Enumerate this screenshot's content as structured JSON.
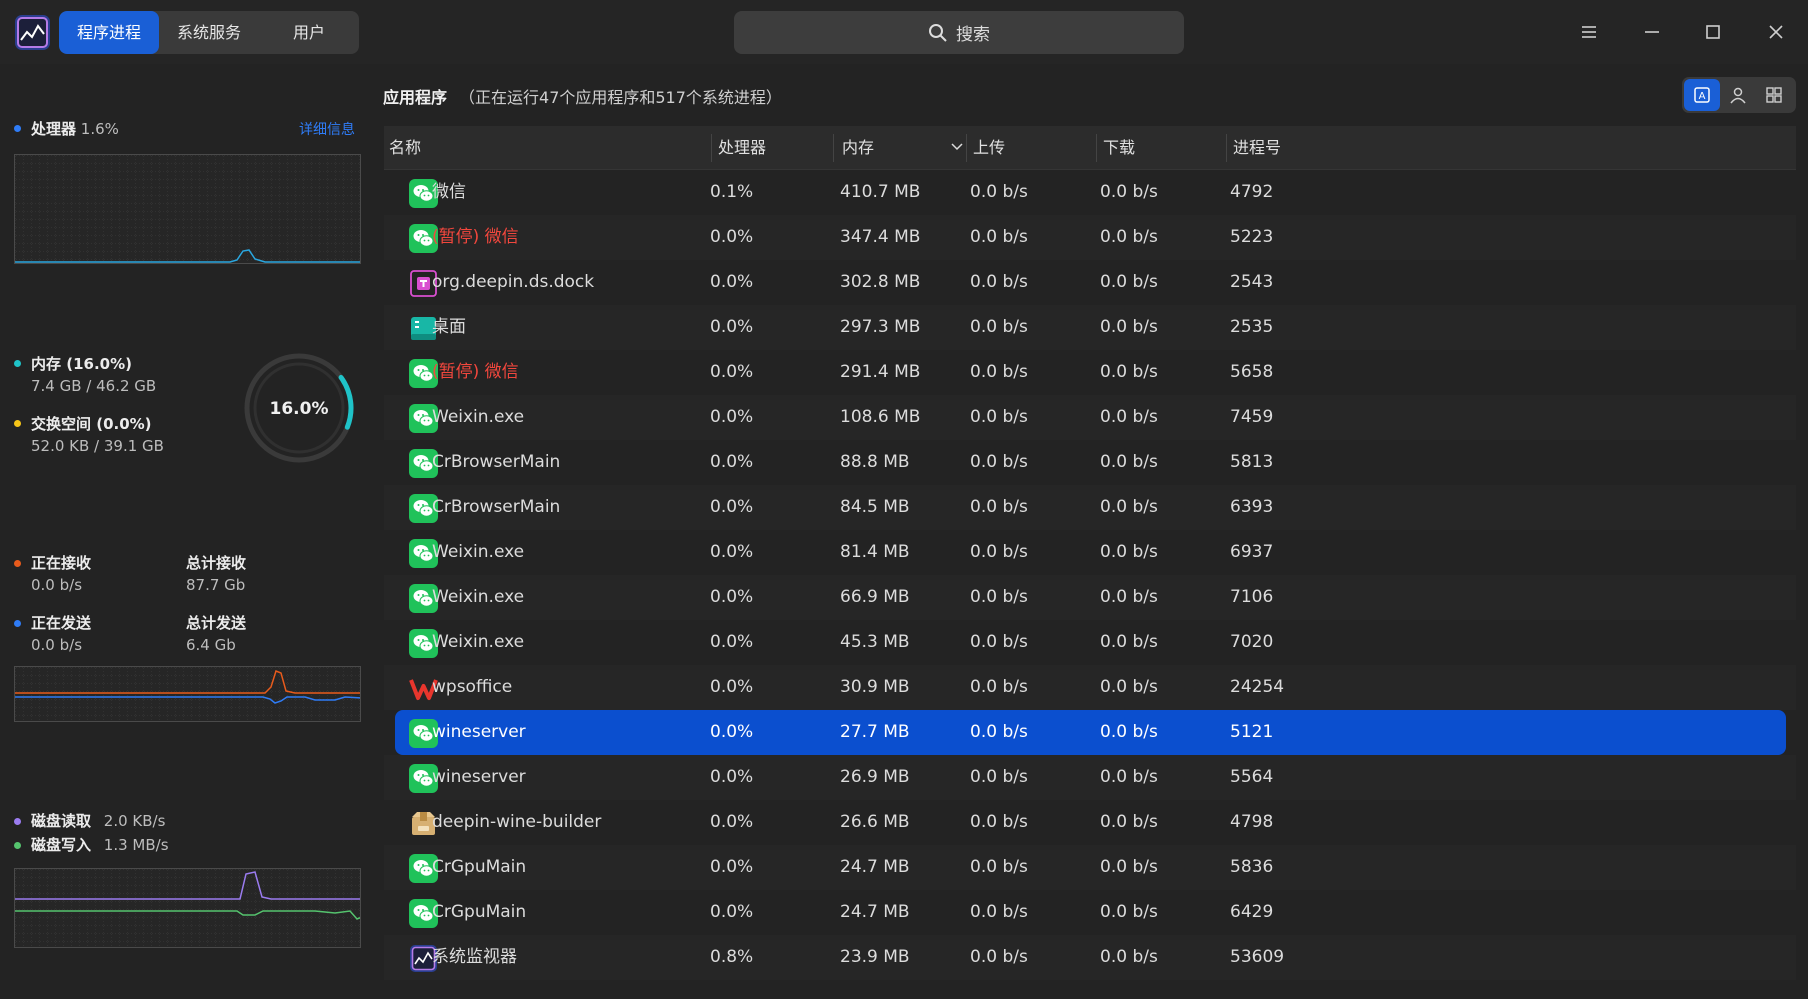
{
  "tabs": [
    "程序进程",
    "系统服务",
    "用户"
  ],
  "search": {
    "label": "搜索"
  },
  "sidebar": {
    "cpu": {
      "label": "处理器",
      "value": "1.6%",
      "detail_link": "详细信息"
    },
    "memory": {
      "label": "内存 (16.0%)",
      "usage": "7.4 GB / 46.2 GB",
      "ring_label": "16.0%",
      "ring_fraction": 0.16
    },
    "swap": {
      "label": "交换空间 (0.0%)",
      "usage": "52.0 KB / 39.1 GB"
    },
    "network": {
      "receiving_label": "正在接收",
      "receiving_value": "0.0 b/s",
      "total_recv_label": "总计接收",
      "total_recv_value": "87.7 Gb",
      "sending_label": "正在发送",
      "sending_value": "0.0 b/s",
      "total_send_label": "总计发送",
      "total_send_value": "6.4 Gb"
    },
    "disk": {
      "read_label": "磁盘读取",
      "read_value": "2.0 KB/s",
      "write_label": "磁盘写入",
      "write_value": "1.3 MB/s"
    }
  },
  "main": {
    "title": "应用程序",
    "subtitle": "（正在运行47个应用程序和517个系统进程）",
    "columns": [
      "名称",
      "处理器",
      "内存",
      "上传",
      "下载",
      "进程号"
    ],
    "rows": [
      {
        "icon": "wechat-icon",
        "name": "微信",
        "cpu": "0.1%",
        "mem": "410.7 MB",
        "up": "0.0 b/s",
        "down": "0.0 b/s",
        "pid": "4792"
      },
      {
        "icon": "wechat-icon",
        "name": "(暂停) 微信",
        "paused": true,
        "cpu": "0.0%",
        "mem": "347.4 MB",
        "up": "0.0 b/s",
        "down": "0.0 b/s",
        "pid": "5223"
      },
      {
        "icon": "dock-icon",
        "name": "org.deepin.ds.dock",
        "cpu": "0.0%",
        "mem": "302.8 MB",
        "up": "0.0 b/s",
        "down": "0.0 b/s",
        "pid": "2543"
      },
      {
        "icon": "desktop-icon",
        "name": "桌面",
        "cpu": "0.0%",
        "mem": "297.3 MB",
        "up": "0.0 b/s",
        "down": "0.0 b/s",
        "pid": "2535"
      },
      {
        "icon": "wechat-icon",
        "name": "(暂停) 微信",
        "paused": true,
        "cpu": "0.0%",
        "mem": "291.4 MB",
        "up": "0.0 b/s",
        "down": "0.0 b/s",
        "pid": "5658"
      },
      {
        "icon": "wechat-icon",
        "name": "Weixin.exe",
        "cpu": "0.0%",
        "mem": "108.6 MB",
        "up": "0.0 b/s",
        "down": "0.0 b/s",
        "pid": "7459"
      },
      {
        "icon": "wechat-icon",
        "name": "CrBrowserMain",
        "cpu": "0.0%",
        "mem": "88.8 MB",
        "up": "0.0 b/s",
        "down": "0.0 b/s",
        "pid": "5813"
      },
      {
        "icon": "wechat-icon",
        "name": "CrBrowserMain",
        "cpu": "0.0%",
        "mem": "84.5 MB",
        "up": "0.0 b/s",
        "down": "0.0 b/s",
        "pid": "6393"
      },
      {
        "icon": "wechat-icon",
        "name": "Weixin.exe",
        "cpu": "0.0%",
        "mem": "81.4 MB",
        "up": "0.0 b/s",
        "down": "0.0 b/s",
        "pid": "6937"
      },
      {
        "icon": "wechat-icon",
        "name": "Weixin.exe",
        "cpu": "0.0%",
        "mem": "66.9 MB",
        "up": "0.0 b/s",
        "down": "0.0 b/s",
        "pid": "7106"
      },
      {
        "icon": "wechat-icon",
        "name": "Weixin.exe",
        "cpu": "0.0%",
        "mem": "45.3 MB",
        "up": "0.0 b/s",
        "down": "0.0 b/s",
        "pid": "7020"
      },
      {
        "icon": "wps-icon",
        "name": "wpsoffice",
        "cpu": "0.0%",
        "mem": "30.9 MB",
        "up": "0.0 b/s",
        "down": "0.0 b/s",
        "pid": "24254"
      },
      {
        "icon": "wechat-icon",
        "name": "wineserver",
        "selected": true,
        "cpu": "0.0%",
        "mem": "27.7 MB",
        "up": "0.0 b/s",
        "down": "0.0 b/s",
        "pid": "5121"
      },
      {
        "icon": "wechat-icon",
        "name": "wineserver",
        "cpu": "0.0%",
        "mem": "26.9 MB",
        "up": "0.0 b/s",
        "down": "0.0 b/s",
        "pid": "5564"
      },
      {
        "icon": "package-icon",
        "name": "deepin-wine-builder",
        "cpu": "0.0%",
        "mem": "26.6 MB",
        "up": "0.0 b/s",
        "down": "0.0 b/s",
        "pid": "4798"
      },
      {
        "icon": "wechat-icon",
        "name": "CrGpuMain",
        "cpu": "0.0%",
        "mem": "24.7 MB",
        "up": "0.0 b/s",
        "down": "0.0 b/s",
        "pid": "5836"
      },
      {
        "icon": "wechat-icon",
        "name": "CrGpuMain",
        "cpu": "0.0%",
        "mem": "24.7 MB",
        "up": "0.0 b/s",
        "down": "0.0 b/s",
        "pid": "6429"
      },
      {
        "icon": "system-monitor-icon",
        "name": "系统监视器",
        "cpu": "0.8%",
        "mem": "23.9 MB",
        "up": "0.0 b/s",
        "down": "0.0 b/s",
        "pid": "53609"
      }
    ]
  },
  "colors": {
    "accent": "#1a5fd6",
    "paused": "#f2473d",
    "cpu_line": "#2aa7e0",
    "memory": "#1fc3c8",
    "swap": "#f5c518",
    "recv": "#e85b1c",
    "send": "#2f7cf6",
    "disk_read": "#9b7cf0",
    "disk_write": "#55c46e"
  }
}
